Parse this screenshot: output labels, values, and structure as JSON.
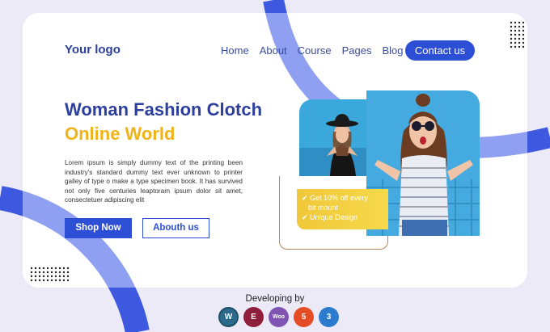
{
  "header": {
    "logo": "Your logo",
    "nav": [
      "Home",
      "About",
      "Course",
      "Pages",
      "Blog"
    ],
    "contact_label": "Contact us"
  },
  "hero": {
    "title_line1": "Woman Fashion Clotch",
    "title_line2": "Online World",
    "paragraph": "Lorem ipsum is simply dummy text of the printing been industry's standard dummy text ever unknown to printer galley of type o make a type specimen book. It has survived not only five centuries leaptoram ipsum dolor sit amet, consectetuer adipiscing elit",
    "shop_label": "Shop Now",
    "about_label": "Abouth us"
  },
  "promo": {
    "line1": "Get 10% off every",
    "line2": "bit mount",
    "line3": "Unique Design"
  },
  "footer": {
    "developing_label": "Developing by",
    "tech_icons": [
      "wordpress-icon",
      "elementor-icon",
      "woocommerce-icon",
      "html5-icon",
      "css3-icon"
    ]
  },
  "colors": {
    "primary": "#2d4fd6",
    "accent": "#f0b41a",
    "heading": "#2c3e9e",
    "background": "#eceaf6",
    "deco": "#7b8ff0"
  }
}
